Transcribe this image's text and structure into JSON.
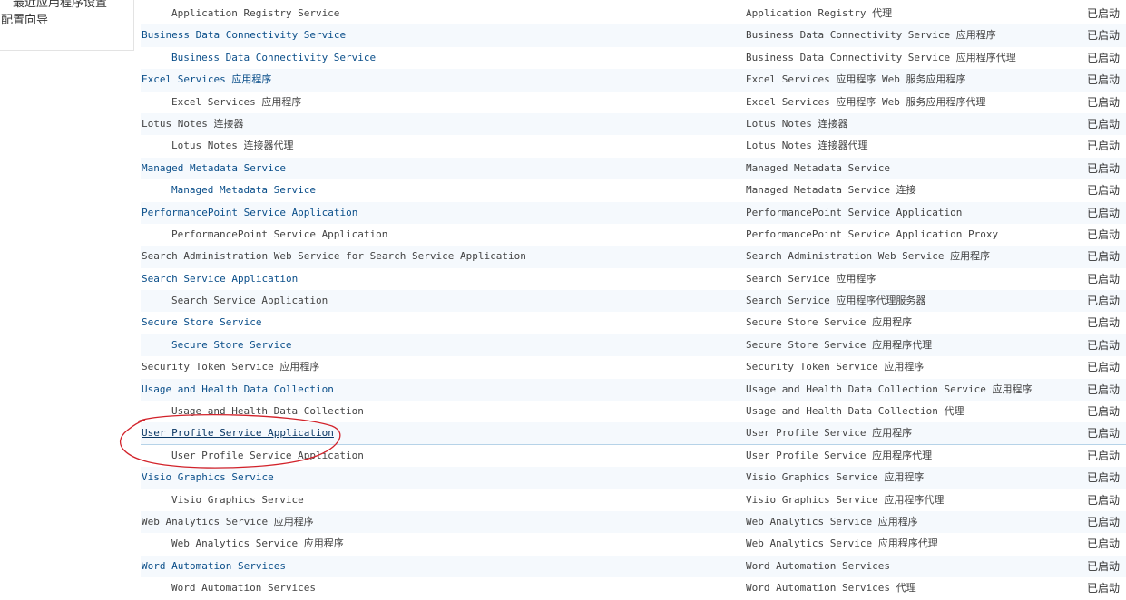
{
  "nav": {
    "top_item": "最近应用程序设置",
    "wizard": "配置向导"
  },
  "rows": [
    {
      "name": "Application Registry Service",
      "type": "Application Registry 代理",
      "status": "已启动",
      "child": true,
      "link": false
    },
    {
      "name": "Business Data Connectivity Service",
      "type": "Business Data Connectivity Service 应用程序",
      "status": "已启动",
      "child": false,
      "link": true
    },
    {
      "name": "Business Data Connectivity Service",
      "type": "Business Data Connectivity Service 应用程序代理",
      "status": "已启动",
      "child": true,
      "link": true
    },
    {
      "name": "Excel Services 应用程序",
      "type": "Excel Services 应用程序 Web 服务应用程序",
      "status": "已启动",
      "child": false,
      "link": true
    },
    {
      "name": "Excel Services 应用程序",
      "type": "Excel Services 应用程序 Web 服务应用程序代理",
      "status": "已启动",
      "child": true,
      "link": false
    },
    {
      "name": "Lotus Notes 连接器",
      "type": "Lotus Notes 连接器",
      "status": "已启动",
      "child": false,
      "link": false
    },
    {
      "name": "Lotus Notes 连接器代理",
      "type": "Lotus Notes 连接器代理",
      "status": "已启动",
      "child": true,
      "link": false
    },
    {
      "name": "Managed Metadata Service",
      "type": "Managed Metadata Service",
      "status": "已启动",
      "child": false,
      "link": true
    },
    {
      "name": "Managed Metadata Service",
      "type": "Managed Metadata Service 连接",
      "status": "已启动",
      "child": true,
      "link": true
    },
    {
      "name": "PerformancePoint Service Application",
      "type": "PerformancePoint Service Application",
      "status": "已启动",
      "child": false,
      "link": true
    },
    {
      "name": "PerformancePoint Service Application",
      "type": "PerformancePoint Service Application Proxy",
      "status": "已启动",
      "child": true,
      "link": false
    },
    {
      "name": "Search Administration Web Service for Search Service Application",
      "type": "Search Administration Web Service 应用程序",
      "status": "已启动",
      "child": false,
      "link": false
    },
    {
      "name": "Search Service Application",
      "type": "Search Service 应用程序",
      "status": "已启动",
      "child": false,
      "link": true
    },
    {
      "name": "Search Service Application",
      "type": "Search Service 应用程序代理服务器",
      "status": "已启动",
      "child": true,
      "link": false
    },
    {
      "name": "Secure Store Service",
      "type": "Secure Store Service 应用程序",
      "status": "已启动",
      "child": false,
      "link": true
    },
    {
      "name": "Secure Store Service",
      "type": "Secure Store Service 应用程序代理",
      "status": "已启动",
      "child": true,
      "link": true
    },
    {
      "name": "Security Token Service 应用程序",
      "type": "Security Token Service 应用程序",
      "status": "已启动",
      "child": false,
      "link": false
    },
    {
      "name": "Usage and Health Data Collection",
      "type": "Usage and Health Data Collection Service 应用程序",
      "status": "已启动",
      "child": false,
      "link": true
    },
    {
      "name": "Usage and Health Data Collection",
      "type": "Usage and Health Data Collection 代理",
      "status": "已启动",
      "child": true,
      "link": false
    },
    {
      "name": "User Profile Service Application",
      "type": "User Profile Service 应用程序",
      "status": "已启动",
      "child": false,
      "link": true,
      "focused": true
    },
    {
      "name": "User Profile Service Application",
      "type": "User Profile Service 应用程序代理",
      "status": "已启动",
      "child": true,
      "link": false
    },
    {
      "name": "Visio Graphics Service",
      "type": "Visio Graphics Service 应用程序",
      "status": "已启动",
      "child": false,
      "link": true
    },
    {
      "name": "Visio Graphics Service",
      "type": "Visio Graphics Service 应用程序代理",
      "status": "已启动",
      "child": true,
      "link": false
    },
    {
      "name": "Web Analytics Service 应用程序",
      "type": "Web Analytics Service 应用程序",
      "status": "已启动",
      "child": false,
      "link": false
    },
    {
      "name": "Web Analytics Service 应用程序",
      "type": "Web Analytics Service 应用程序代理",
      "status": "已启动",
      "child": true,
      "link": false
    },
    {
      "name": "Word Automation Services",
      "type": "Word Automation Services",
      "status": "已启动",
      "child": false,
      "link": true
    },
    {
      "name": "Word Automation Services",
      "type": "Word Automation Services 代理",
      "status": "已启动",
      "child": true,
      "link": false
    }
  ],
  "colors": {
    "link": "#0b4f8a",
    "text": "#444444",
    "row_alt": "#f5f9fd",
    "annotation_circle": "#d2222a"
  }
}
